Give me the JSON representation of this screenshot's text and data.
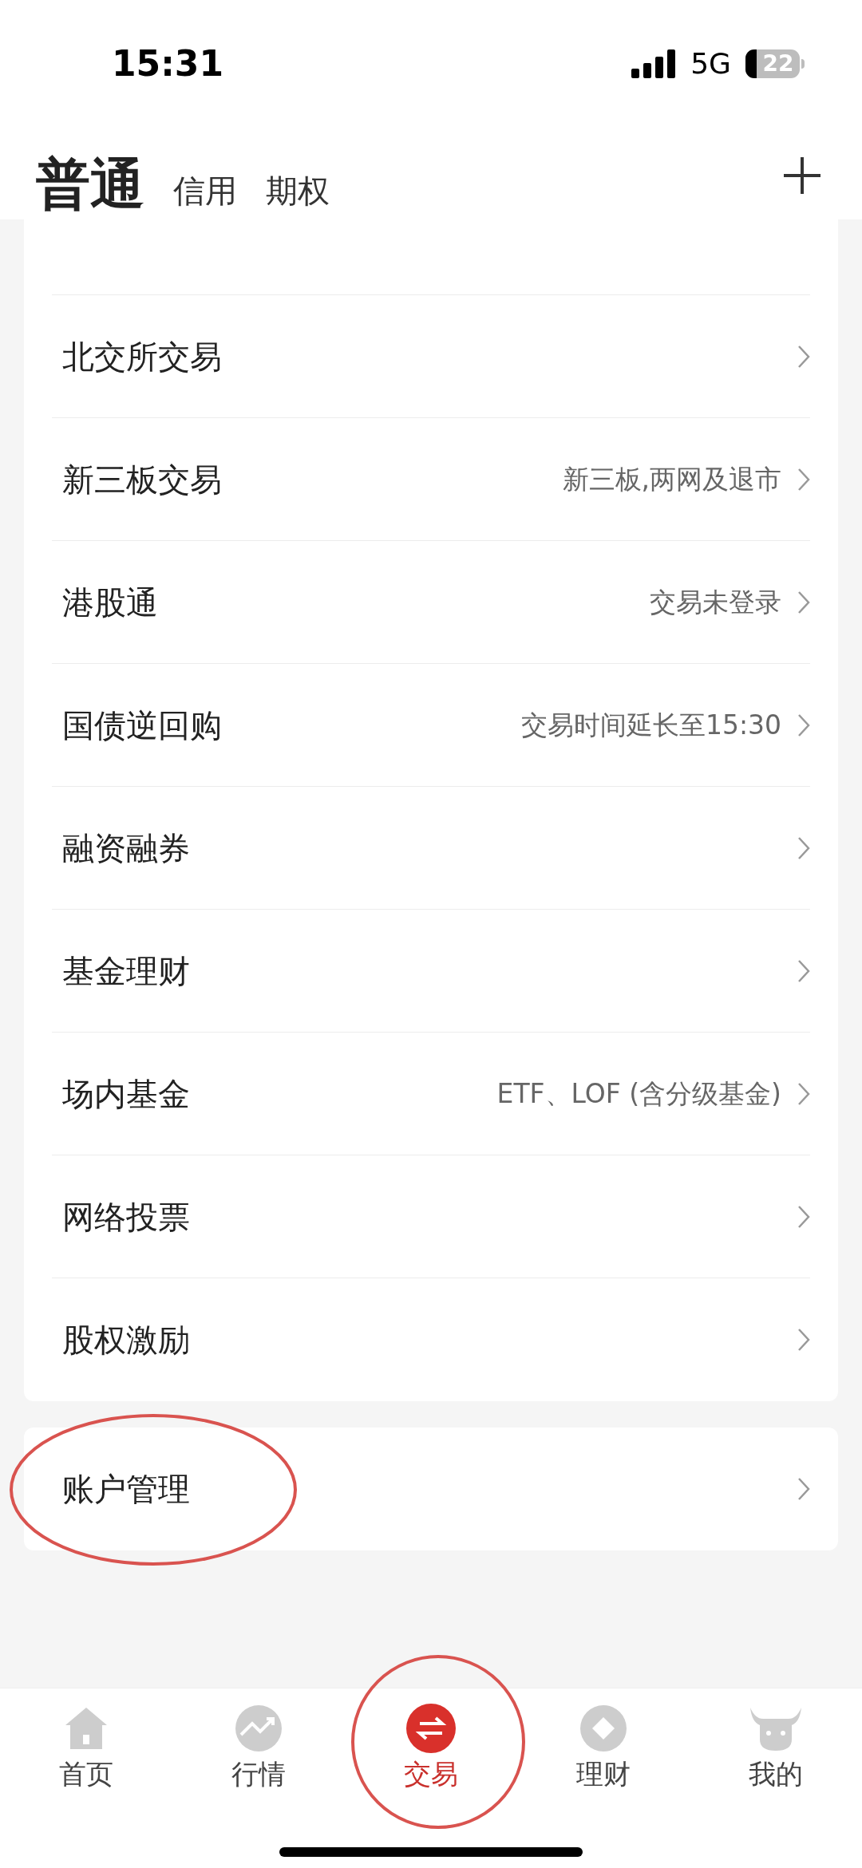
{
  "status_bar": {
    "time": "15:31",
    "network": "5G",
    "battery": "22"
  },
  "tabs": [
    {
      "label": "普通",
      "selected": true
    },
    {
      "label": "信用",
      "selected": false
    },
    {
      "label": "期权",
      "selected": false
    }
  ],
  "menu": [
    {
      "label": "北交所交易"
    },
    {
      "label": "新三板交易",
      "detail": "新三板,两网及退市"
    },
    {
      "label": "港股通",
      "detail": "交易未登录"
    },
    {
      "label": "国债逆回购",
      "detail": "交易时间延长至15:30"
    },
    {
      "label": "融资融券"
    },
    {
      "label": "基金理财"
    },
    {
      "label": "场内基金",
      "detail": "ETF、LOF (含分级基金)"
    },
    {
      "label": "网络投票"
    },
    {
      "label": "股权激励"
    }
  ],
  "account_menu": [
    {
      "label": "账户管理"
    }
  ],
  "bottom_nav": [
    {
      "label": "首页",
      "kind": "home",
      "selected": false
    },
    {
      "label": "行情",
      "kind": "market",
      "selected": false
    },
    {
      "label": "交易",
      "kind": "trade",
      "selected": true
    },
    {
      "label": "理财",
      "kind": "wealth",
      "selected": false
    },
    {
      "label": "我的",
      "kind": "profile",
      "selected": false
    }
  ]
}
